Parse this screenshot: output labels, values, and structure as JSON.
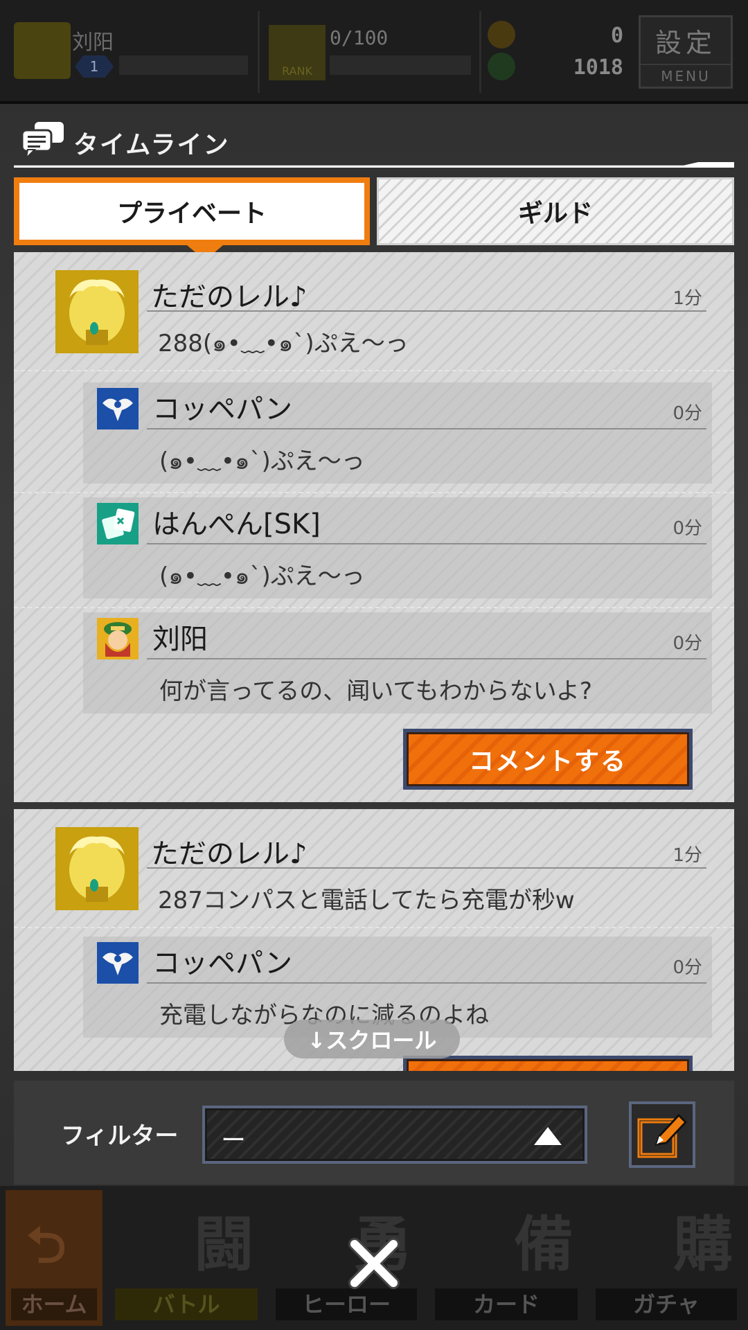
{
  "topbar": {
    "player_name": "刘阳",
    "level": "1",
    "rank_text": "0/100",
    "rank_label": "RANK",
    "currency_1": "0",
    "currency_2": "1018",
    "menu_kanji": "設定",
    "menu_label": "MENU"
  },
  "panel": {
    "title": "タイムライン",
    "tabs": [
      {
        "label": "プライベート",
        "active": true
      },
      {
        "label": "ギルド",
        "active": false
      }
    ],
    "cards": [
      {
        "posts": [
          {
            "name": "ただのレル♪",
            "time": "1分",
            "message": "288(๑•﹏•๑`)ぷえ〜っ",
            "avatar": "laurel-crown-avatar"
          },
          {
            "name": "コッペパン",
            "time": "0分",
            "message": "(๑•﹏•๑`)ぷえ〜っ",
            "avatar": "eagle-avatar"
          },
          {
            "name": "はんぺん[SK]",
            "time": "0分",
            "message": "(๑•﹏•๑`)ぷえ〜っ",
            "avatar": "cards-avatar"
          },
          {
            "name": "刘阳",
            "time": "0分",
            "message": "何が言ってるの、闻いてもわからないよ?",
            "avatar": "hero-avatar"
          }
        ],
        "comment_label": "コメントする"
      },
      {
        "posts": [
          {
            "name": "ただのレル♪",
            "time": "1分",
            "message": "287コンパスと電話してたら充電が秒w",
            "avatar": "laurel-crown-avatar"
          },
          {
            "name": "コッペパン",
            "time": "0分",
            "message": "充電しながらなのに減るのよね",
            "avatar": "eagle-avatar"
          }
        ]
      }
    ],
    "scroll_hint": "↓スクロール",
    "filter_label": "フィルター",
    "filter_value": "ー"
  },
  "bottom_nav": [
    {
      "label": "ホーム",
      "kanji": ""
    },
    {
      "label": "バトル",
      "kanji": "闘"
    },
    {
      "label": "ヒーロー",
      "kanji": "勇"
    },
    {
      "label": "カード",
      "kanji": "備"
    },
    {
      "label": "ガチャ",
      "kanji": "購"
    }
  ],
  "colors": {
    "accent_orange": "#f07d0f",
    "avatar_gold": "#c8a010",
    "avatar_blue": "#1b4fa8",
    "avatar_teal": "#17a085"
  },
  "icons": {
    "timeline": "speech-bubbles-icon",
    "close": "close-icon",
    "compose": "edit-pencil-icon",
    "filter_caret": "triangle-up-icon"
  }
}
